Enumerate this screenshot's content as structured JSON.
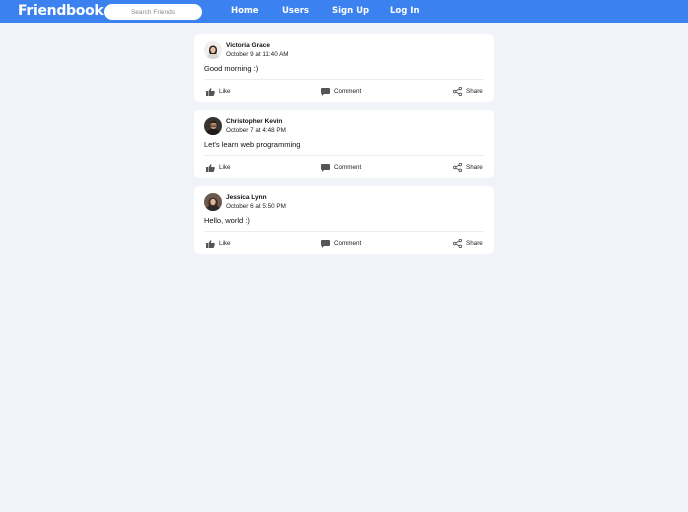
{
  "app": {
    "brand": "Friendbook",
    "search_placeholder": "Search Friends",
    "nav": [
      {
        "label": "Home"
      },
      {
        "label": "Users"
      },
      {
        "label": "Sign Up"
      },
      {
        "label": "Log In"
      }
    ]
  },
  "colors": {
    "navbar": "#3b82f0",
    "background": "#f0f3f7",
    "card": "#ffffff"
  },
  "actions": {
    "like": "Like",
    "comment": "Comment",
    "share": "Share",
    "icons": [
      "thumbs-up-icon",
      "speech-bubble-icon",
      "share-icon"
    ]
  },
  "posts": [
    {
      "author": "Victoria Grace",
      "time": "October 9 at 11:40 AM",
      "content": "Good morning :)"
    },
    {
      "author": "Christopher Kevin",
      "time": "October 7 at 4:48 PM",
      "content": "Let's learn web programming"
    },
    {
      "author": "Jessica Lynn",
      "time": "October 6 at 5:50 PM",
      "content": "Hello, world :)"
    }
  ]
}
